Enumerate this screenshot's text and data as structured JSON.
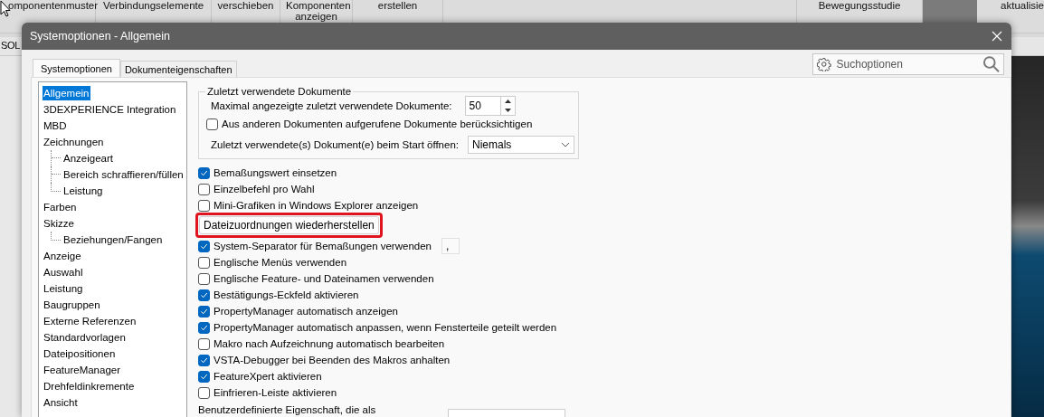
{
  "ribbon": {
    "items": [
      "omponentenmuster",
      "Verbindungselemente",
      "verschieben",
      "Komponenten anzeigen",
      "erstellen",
      "Bewegungsstudie",
      "aktualisie"
    ]
  },
  "document_bar": {
    "tab": "SOL"
  },
  "dialog": {
    "title": "Systemoptionen - Allgemein",
    "tabs": [
      {
        "label": "Systemoptionen",
        "selected": true
      },
      {
        "label": "Dokumenteigenschaften",
        "selected": false
      }
    ],
    "search": {
      "placeholder": "Suchoptionen"
    },
    "tree": [
      {
        "label": "Allgemein",
        "selected": true
      },
      {
        "label": "3DEXPERIENCE Integration",
        "selected": false
      },
      {
        "label": "MBD",
        "selected": false
      },
      {
        "label": "Zeichnungen",
        "selected": false,
        "children": [
          {
            "label": "Anzeigeart",
            "selected": false
          },
          {
            "label": "Bereich schraffieren/füllen",
            "selected": false
          },
          {
            "label": "Leistung",
            "selected": false
          }
        ]
      },
      {
        "label": "Farben",
        "selected": false
      },
      {
        "label": "Skizze",
        "selected": false,
        "children": [
          {
            "label": "Beziehungen/Fangen",
            "selected": false
          }
        ]
      },
      {
        "label": "Anzeige",
        "selected": false
      },
      {
        "label": "Auswahl",
        "selected": false
      },
      {
        "label": "Leistung",
        "selected": false
      },
      {
        "label": "Baugruppen",
        "selected": false
      },
      {
        "label": "Externe Referenzen",
        "selected": false
      },
      {
        "label": "Standardvorlagen",
        "selected": false
      },
      {
        "label": "Dateipositionen",
        "selected": false
      },
      {
        "label": "FeatureManager",
        "selected": false
      },
      {
        "label": "Drehfeldinkremente",
        "selected": false
      },
      {
        "label": "Ansicht",
        "selected": false
      }
    ],
    "recent_docs": {
      "title": "Zuletzt verwendete Dokumente",
      "max_label": "Maximal angezeigte zuletzt verwendete Dokumente:",
      "max_value": "50",
      "include": {
        "label": "Aus anderen Dokumenten aufgerufene Dokumente berücksichtigen",
        "checked": false
      },
      "open_label": "Zuletzt verwendete(s) Dokument(e) beim Start öffnen:",
      "open_value": "Niemals"
    },
    "options": [
      {
        "kind": "checkbox",
        "label": "Bemaßungswert einsetzen",
        "checked": true
      },
      {
        "kind": "checkbox",
        "label": "Einzelbefehl pro Wahl",
        "checked": false
      },
      {
        "kind": "checkbox",
        "label": "Mini-Grafiken in Windows Explorer anzeigen",
        "checked": false
      },
      {
        "kind": "button",
        "label": "Dateizuordnungen wiederherstellen",
        "highlighted": true
      },
      {
        "kind": "checkbox",
        "label": "System-Separator für Bemaßungen verwenden",
        "checked": true,
        "field_value": ","
      },
      {
        "kind": "checkbox",
        "label": "Englische Menüs verwenden",
        "checked": false
      },
      {
        "kind": "checkbox",
        "label": "Englische Feature- und Dateinamen verwenden",
        "checked": false
      },
      {
        "kind": "checkbox",
        "label": "Bestätigungs-Eckfeld aktivieren",
        "checked": true
      },
      {
        "kind": "checkbox",
        "label": "PropertyManager automatisch anzeigen",
        "checked": true
      },
      {
        "kind": "checkbox",
        "label": "PropertyManager automatisch anpassen, wenn Fensterteile geteilt werden",
        "checked": true
      },
      {
        "kind": "checkbox",
        "label": "Makro nach Aufzeichnung automatisch bearbeiten",
        "checked": false
      },
      {
        "kind": "checkbox",
        "label": "VSTA-Debugger bei Beenden des Makros anhalten",
        "checked": true
      },
      {
        "kind": "checkbox",
        "label": "FeatureXpert aktivieren",
        "checked": true
      },
      {
        "kind": "checkbox",
        "label": "Einfrieren-Leiste aktivieren",
        "checked": false
      }
    ],
    "custom_property": {
      "label": "Benutzerdefinierte Eigenschaft, die als"
    }
  }
}
